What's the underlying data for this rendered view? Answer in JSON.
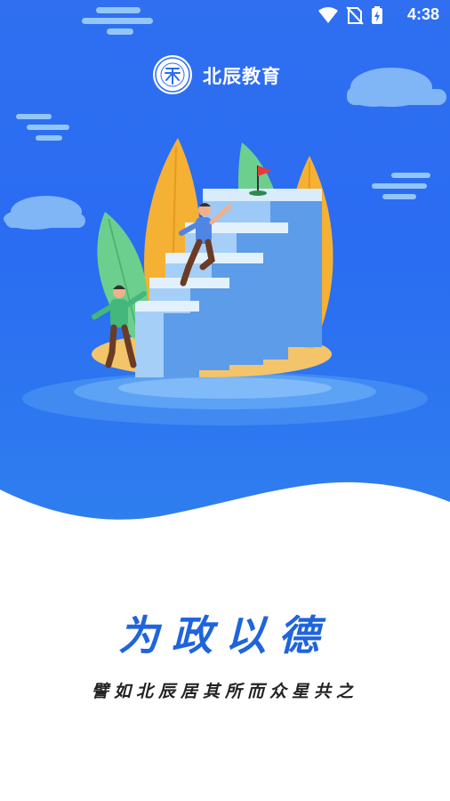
{
  "status_bar": {
    "time": "4:38",
    "icons": [
      "wifi-icon",
      "no-sim-icon",
      "battery-charging-icon"
    ]
  },
  "brand": {
    "name": "北辰教育",
    "logo": "beichen-seal-logo"
  },
  "illustration": {
    "subject": "people-climbing-book-stairs-flag-on-top",
    "colors": {
      "books": "#7fb6f0",
      "leaves_orange": "#f5b133",
      "leaves_green": "#6ccf8e",
      "island": "#f3c46a"
    }
  },
  "slogan": {
    "motto": "为政以德",
    "quote": "譬如北辰居其所而众星共之"
  },
  "colors": {
    "hero_blue": "#2a6cf2",
    "motto_blue": "#1f64dc",
    "quote_text": "#222222"
  }
}
